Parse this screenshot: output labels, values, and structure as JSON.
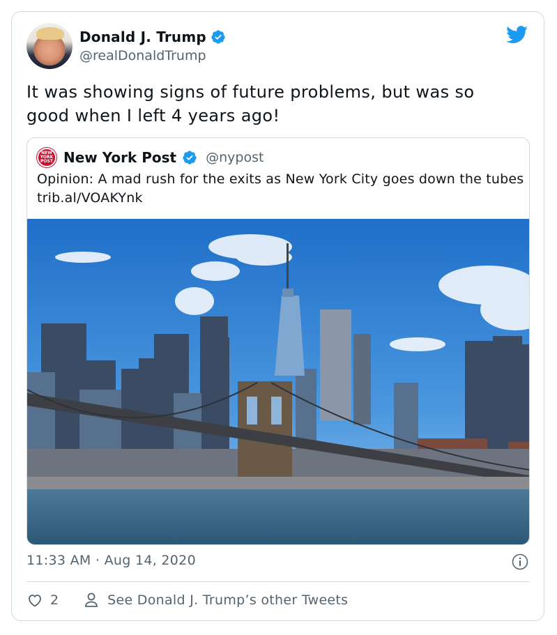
{
  "tweet": {
    "author_name": "Donald J. Trump",
    "author_handle": "@realDonaldTrump",
    "text": "It was showing signs of future problems, but was so\ngood when I left 4 years ago!",
    "timestamp": "11:33 AM · Aug 14, 2020",
    "likes": "2",
    "see_other": "See Donald J. Trump’s other Tweets",
    "icons": [
      "verified-badge-icon",
      "twitter-bird-icon",
      "info-icon",
      "heart-icon",
      "person-icon"
    ]
  },
  "quote": {
    "logo_text": "NEW YORK POST",
    "author_name": "New York Post",
    "author_handle": "@nypost",
    "text": "Opinion: A mad rush for the exits as New York City goes down the tubes trib.al/VOAKYnk"
  },
  "colors": {
    "verified": "#1d9bf0",
    "twitter_blue": "#1d9bf0",
    "nypost_red": "#c8102e",
    "secondary_text": "#536471",
    "border": "#cfd9de"
  }
}
